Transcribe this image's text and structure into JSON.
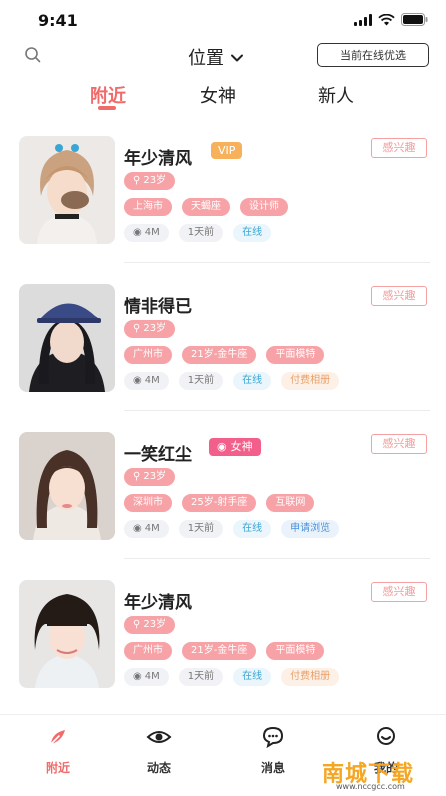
{
  "status": {
    "time": "9:41"
  },
  "header": {
    "location_label": "位置",
    "online_filter_label": "当前在线优选"
  },
  "tabs": [
    {
      "label": "附近",
      "active": true
    },
    {
      "label": "女神",
      "active": false
    },
    {
      "label": "新人",
      "active": false
    }
  ],
  "users": [
    {
      "name": "年少清风",
      "badge": "VIP",
      "badge_type": "vip",
      "interest_label": "感兴趣",
      "age": "23岁",
      "tags": [
        "上海市",
        "天蝎座",
        "设计师"
      ],
      "distance": "4M",
      "last_active": "1天前",
      "status": "在线",
      "extra": ""
    },
    {
      "name": "情非得已",
      "badge": "",
      "badge_type": "",
      "interest_label": "感兴趣",
      "age": "23岁",
      "tags": [
        "广州市",
        "21岁-金牛座",
        "平面模特"
      ],
      "distance": "4M",
      "last_active": "1天前",
      "status": "在线",
      "extra": "付费相册"
    },
    {
      "name": "一笑红尘",
      "badge": "女神",
      "badge_type": "goddess",
      "interest_label": "感兴趣",
      "age": "23岁",
      "tags": [
        "深圳市",
        "25岁-射手座",
        "互联网"
      ],
      "distance": "4M",
      "last_active": "1天前",
      "status": "在线",
      "extra": "申请浏览"
    },
    {
      "name": "年少清风",
      "badge": "",
      "badge_type": "",
      "interest_label": "感兴趣",
      "age": "23岁",
      "tags": [
        "广州市",
        "21岁-金牛座",
        "平面模特"
      ],
      "distance": "4M",
      "last_active": "1天前",
      "status": "在线",
      "extra": "付费相册"
    }
  ],
  "nav": [
    {
      "label": "附近",
      "icon": "feather-icon",
      "active": true
    },
    {
      "label": "动态",
      "icon": "eye-icon",
      "active": false
    },
    {
      "label": "消息",
      "icon": "chat-icon",
      "active": false
    },
    {
      "label": "我的",
      "icon": "profile-icon",
      "active": false
    }
  ],
  "watermark": {
    "text": "南城下载",
    "url": "www.nccgcc.com"
  },
  "colors": {
    "accent": "#f06b6b",
    "pill": "#f6a2a6",
    "vip": "#f6b15a",
    "goddess": "#f25f8a"
  }
}
